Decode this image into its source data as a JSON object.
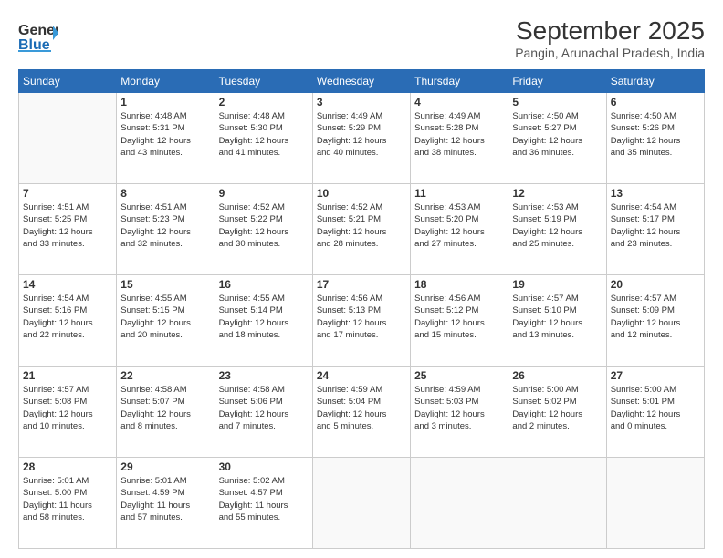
{
  "header": {
    "logo_line1": "General",
    "logo_line2": "Blue",
    "title": "September 2025",
    "subtitle": "Pangin, Arunachal Pradesh, India"
  },
  "weekdays": [
    "Sunday",
    "Monday",
    "Tuesday",
    "Wednesday",
    "Thursday",
    "Friday",
    "Saturday"
  ],
  "weeks": [
    [
      {
        "day": "",
        "info": ""
      },
      {
        "day": "1",
        "info": "Sunrise: 4:48 AM\nSunset: 5:31 PM\nDaylight: 12 hours\nand 43 minutes."
      },
      {
        "day": "2",
        "info": "Sunrise: 4:48 AM\nSunset: 5:30 PM\nDaylight: 12 hours\nand 41 minutes."
      },
      {
        "day": "3",
        "info": "Sunrise: 4:49 AM\nSunset: 5:29 PM\nDaylight: 12 hours\nand 40 minutes."
      },
      {
        "day": "4",
        "info": "Sunrise: 4:49 AM\nSunset: 5:28 PM\nDaylight: 12 hours\nand 38 minutes."
      },
      {
        "day": "5",
        "info": "Sunrise: 4:50 AM\nSunset: 5:27 PM\nDaylight: 12 hours\nand 36 minutes."
      },
      {
        "day": "6",
        "info": "Sunrise: 4:50 AM\nSunset: 5:26 PM\nDaylight: 12 hours\nand 35 minutes."
      }
    ],
    [
      {
        "day": "7",
        "info": "Sunrise: 4:51 AM\nSunset: 5:25 PM\nDaylight: 12 hours\nand 33 minutes."
      },
      {
        "day": "8",
        "info": "Sunrise: 4:51 AM\nSunset: 5:23 PM\nDaylight: 12 hours\nand 32 minutes."
      },
      {
        "day": "9",
        "info": "Sunrise: 4:52 AM\nSunset: 5:22 PM\nDaylight: 12 hours\nand 30 minutes."
      },
      {
        "day": "10",
        "info": "Sunrise: 4:52 AM\nSunset: 5:21 PM\nDaylight: 12 hours\nand 28 minutes."
      },
      {
        "day": "11",
        "info": "Sunrise: 4:53 AM\nSunset: 5:20 PM\nDaylight: 12 hours\nand 27 minutes."
      },
      {
        "day": "12",
        "info": "Sunrise: 4:53 AM\nSunset: 5:19 PM\nDaylight: 12 hours\nand 25 minutes."
      },
      {
        "day": "13",
        "info": "Sunrise: 4:54 AM\nSunset: 5:17 PM\nDaylight: 12 hours\nand 23 minutes."
      }
    ],
    [
      {
        "day": "14",
        "info": "Sunrise: 4:54 AM\nSunset: 5:16 PM\nDaylight: 12 hours\nand 22 minutes."
      },
      {
        "day": "15",
        "info": "Sunrise: 4:55 AM\nSunset: 5:15 PM\nDaylight: 12 hours\nand 20 minutes."
      },
      {
        "day": "16",
        "info": "Sunrise: 4:55 AM\nSunset: 5:14 PM\nDaylight: 12 hours\nand 18 minutes."
      },
      {
        "day": "17",
        "info": "Sunrise: 4:56 AM\nSunset: 5:13 PM\nDaylight: 12 hours\nand 17 minutes."
      },
      {
        "day": "18",
        "info": "Sunrise: 4:56 AM\nSunset: 5:12 PM\nDaylight: 12 hours\nand 15 minutes."
      },
      {
        "day": "19",
        "info": "Sunrise: 4:57 AM\nSunset: 5:10 PM\nDaylight: 12 hours\nand 13 minutes."
      },
      {
        "day": "20",
        "info": "Sunrise: 4:57 AM\nSunset: 5:09 PM\nDaylight: 12 hours\nand 12 minutes."
      }
    ],
    [
      {
        "day": "21",
        "info": "Sunrise: 4:57 AM\nSunset: 5:08 PM\nDaylight: 12 hours\nand 10 minutes."
      },
      {
        "day": "22",
        "info": "Sunrise: 4:58 AM\nSunset: 5:07 PM\nDaylight: 12 hours\nand 8 minutes."
      },
      {
        "day": "23",
        "info": "Sunrise: 4:58 AM\nSunset: 5:06 PM\nDaylight: 12 hours\nand 7 minutes."
      },
      {
        "day": "24",
        "info": "Sunrise: 4:59 AM\nSunset: 5:04 PM\nDaylight: 12 hours\nand 5 minutes."
      },
      {
        "day": "25",
        "info": "Sunrise: 4:59 AM\nSunset: 5:03 PM\nDaylight: 12 hours\nand 3 minutes."
      },
      {
        "day": "26",
        "info": "Sunrise: 5:00 AM\nSunset: 5:02 PM\nDaylight: 12 hours\nand 2 minutes."
      },
      {
        "day": "27",
        "info": "Sunrise: 5:00 AM\nSunset: 5:01 PM\nDaylight: 12 hours\nand 0 minutes."
      }
    ],
    [
      {
        "day": "28",
        "info": "Sunrise: 5:01 AM\nSunset: 5:00 PM\nDaylight: 11 hours\nand 58 minutes."
      },
      {
        "day": "29",
        "info": "Sunrise: 5:01 AM\nSunset: 4:59 PM\nDaylight: 11 hours\nand 57 minutes."
      },
      {
        "day": "30",
        "info": "Sunrise: 5:02 AM\nSunset: 4:57 PM\nDaylight: 11 hours\nand 55 minutes."
      },
      {
        "day": "",
        "info": ""
      },
      {
        "day": "",
        "info": ""
      },
      {
        "day": "",
        "info": ""
      },
      {
        "day": "",
        "info": ""
      }
    ]
  ]
}
